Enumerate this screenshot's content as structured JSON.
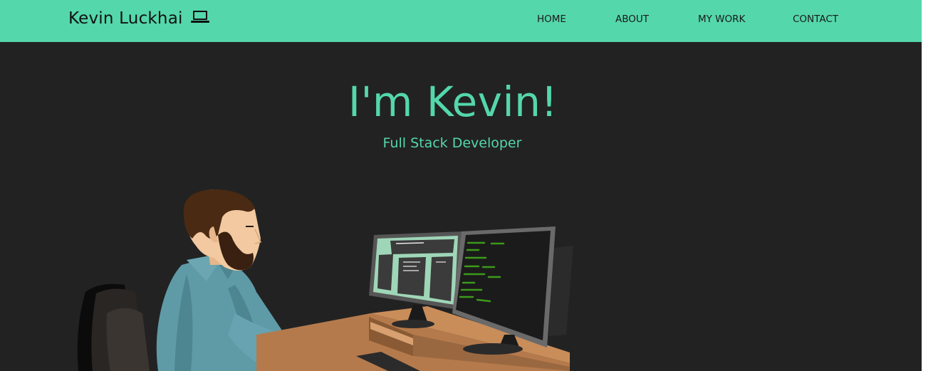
{
  "header": {
    "brand": "Kevin Luckhai",
    "brand_icon": "laptop-icon",
    "nav": [
      {
        "label": "HOME"
      },
      {
        "label": "ABOUT"
      },
      {
        "label": "MY WORK"
      },
      {
        "label": "CONTACT"
      }
    ]
  },
  "hero": {
    "title": "I'm Kevin!",
    "subtitle": "Full Stack Developer",
    "illustration": "developer-at-desk-illustration"
  },
  "colors": {
    "accent": "#54d7ab",
    "background": "#222222",
    "header_text": "#111111"
  }
}
